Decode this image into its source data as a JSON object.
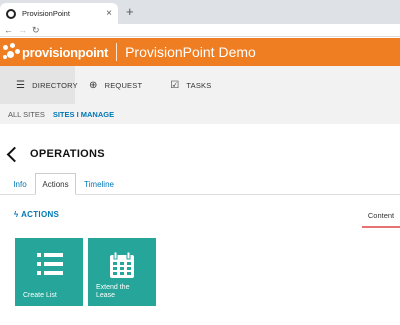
{
  "browser": {
    "tab_title": "ProvisionPoint",
    "new_tab": "+",
    "close": "×"
  },
  "header": {
    "logo_text": "provisionpoint",
    "app_title": "ProvisionPoint Demo",
    "brand_color": "#ef7d22"
  },
  "topnav": {
    "items": [
      {
        "label": "DIRECTORY",
        "icon": "list-icon",
        "active": true
      },
      {
        "label": "REQUEST",
        "icon": "plus-circle-icon",
        "active": false
      },
      {
        "label": "TASKS",
        "icon": "checkbox-icon",
        "active": false
      }
    ]
  },
  "subnav": {
    "all_sites": "ALL SITES",
    "sites_i_manage": "SITES I MANAGE"
  },
  "page": {
    "title": "OPERATIONS"
  },
  "tabs": [
    {
      "label": "Info",
      "active": false
    },
    {
      "label": "Actions",
      "active": true
    },
    {
      "label": "Timeline",
      "active": false
    }
  ],
  "actions": {
    "title": "ACTIONS",
    "title_icon": "lightning-icon",
    "content_label": "Content",
    "tiles": [
      {
        "label": "Create List",
        "icon": "list-icon"
      },
      {
        "label": "Extend the Lease",
        "icon": "calendar-icon"
      }
    ],
    "tile_color": "#26a69a"
  }
}
